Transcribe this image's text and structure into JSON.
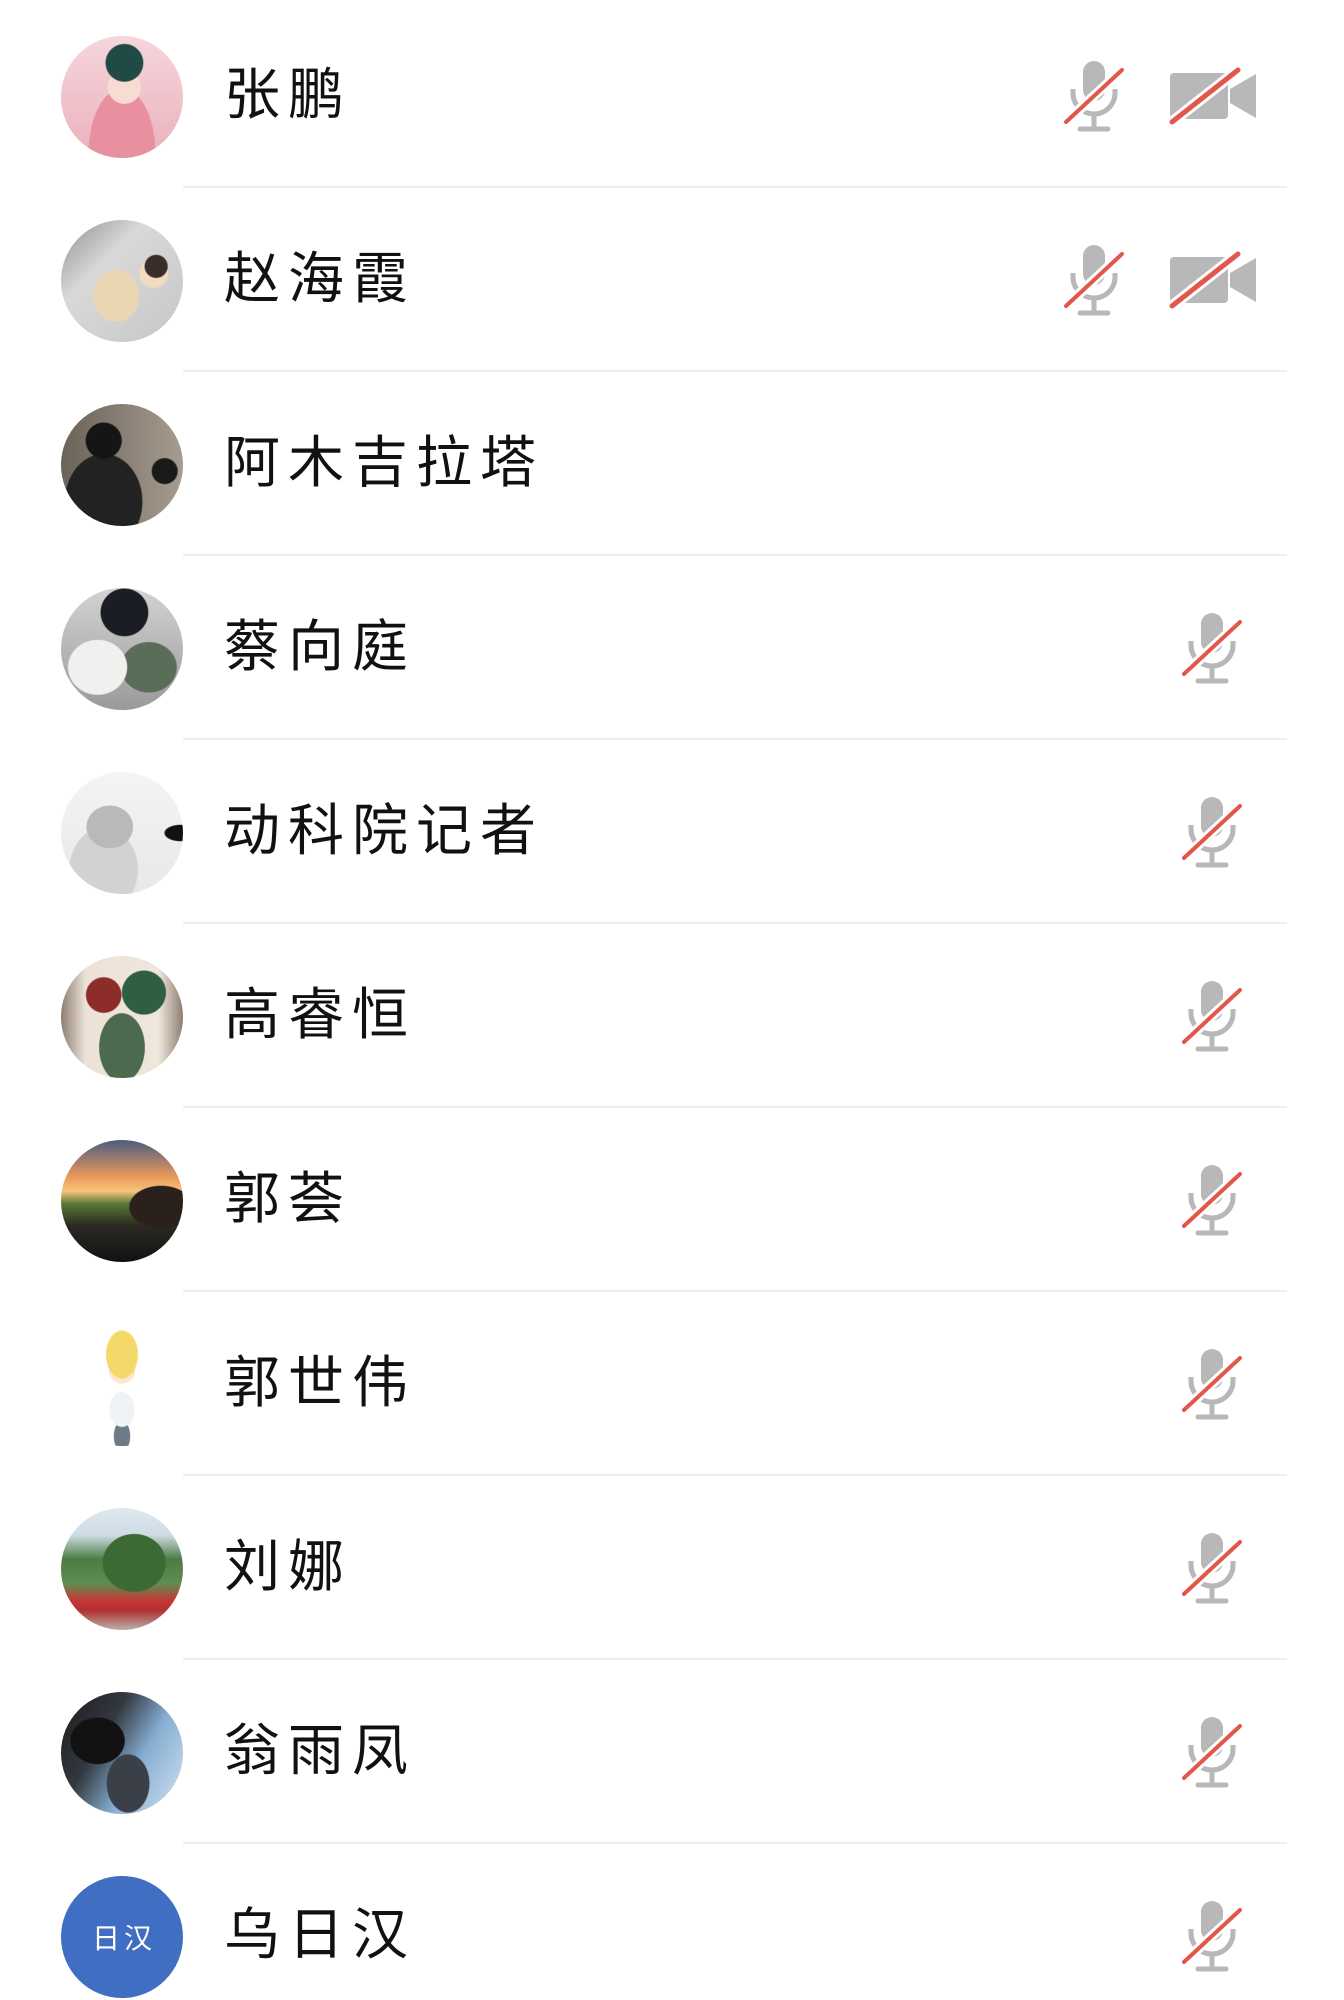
{
  "colors": {
    "icon_gray": "#b8b8b8",
    "slash_red": "#e2574c",
    "divider": "#eeeeee",
    "avatar_blue": "#3f6ec3"
  },
  "participants": [
    {
      "name": "张鹏",
      "mic_icon": "mic-off",
      "camera_icon": "video-off"
    },
    {
      "name": "赵海霞",
      "mic_icon": "mic-off",
      "camera_icon": "video-off"
    },
    {
      "name": "阿木吉拉塔"
    },
    {
      "name": "蔡向庭",
      "mic_icon": "mic-off"
    },
    {
      "name": "动科院记者",
      "mic_icon": "mic-off"
    },
    {
      "name": "高睿恒",
      "mic_icon": "mic-off"
    },
    {
      "name": "郭荟",
      "mic_icon": "mic-off"
    },
    {
      "name": "郭世伟",
      "mic_icon": "mic-off"
    },
    {
      "name": "刘娜",
      "mic_icon": "mic-off"
    },
    {
      "name": "翁雨凤",
      "mic_icon": "mic-off"
    },
    {
      "name": "乌日汉",
      "mic_icon": "mic-off",
      "avatar_text": "日汉"
    }
  ]
}
